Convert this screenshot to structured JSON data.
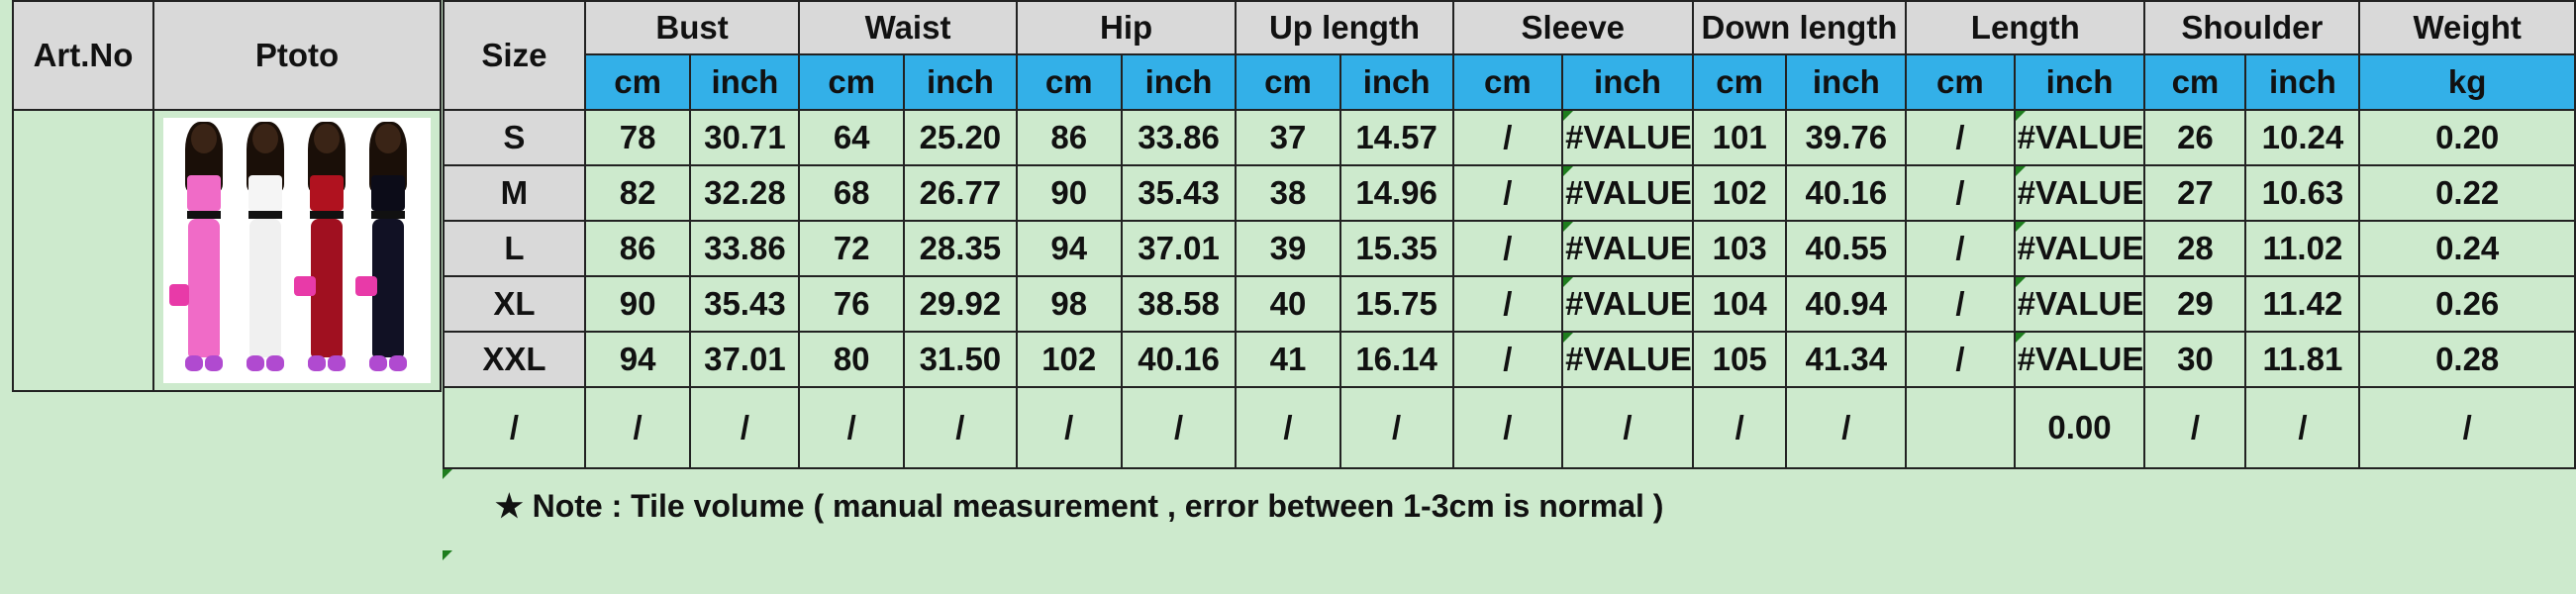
{
  "left_table": {
    "art_no_header": "Art.No",
    "photo_header": "Ptoto",
    "art_no_value": ""
  },
  "photo": {
    "description_icon": "product-photo",
    "figures": [
      {
        "top_color": "#f06bc7",
        "legs_color": "#f06bc7"
      },
      {
        "top_color": "#f5f5f5",
        "legs_color": "#f0f0f0"
      },
      {
        "top_color": "#b0121f",
        "legs_color": "#a01020"
      },
      {
        "top_color": "#0c0c18",
        "legs_color": "#111124"
      }
    ]
  },
  "size_table": {
    "size_header": "Size",
    "groups": [
      {
        "name": "Bust",
        "units": [
          "cm",
          "inch"
        ]
      },
      {
        "name": "Waist",
        "units": [
          "cm",
          "inch"
        ]
      },
      {
        "name": "Hip",
        "units": [
          "cm",
          "inch"
        ]
      },
      {
        "name": "Up length",
        "units": [
          "cm",
          "inch"
        ]
      },
      {
        "name": "Sleeve",
        "units": [
          "cm",
          "inch"
        ]
      },
      {
        "name": "Down length",
        "units": [
          "cm",
          "inch"
        ]
      },
      {
        "name": "Length",
        "units": [
          "cm",
          "inch"
        ]
      },
      {
        "name": "Shoulder",
        "units": [
          "cm",
          "inch"
        ]
      },
      {
        "name": "Weight",
        "units": [
          "kg"
        ]
      }
    ],
    "rows": [
      {
        "size": "S",
        "cells": [
          "78",
          "30.71",
          "64",
          "25.20",
          "86",
          "33.86",
          "37",
          "14.57",
          "/",
          "#VALUE",
          "101",
          "39.76",
          "/",
          "#VALUE",
          "26",
          "10.24",
          "0.20"
        ]
      },
      {
        "size": "M",
        "cells": [
          "82",
          "32.28",
          "68",
          "26.77",
          "90",
          "35.43",
          "38",
          "14.96",
          "/",
          "#VALUE",
          "102",
          "40.16",
          "/",
          "#VALUE",
          "27",
          "10.63",
          "0.22"
        ]
      },
      {
        "size": "L",
        "cells": [
          "86",
          "33.86",
          "72",
          "28.35",
          "94",
          "37.01",
          "39",
          "15.35",
          "/",
          "#VALUE",
          "103",
          "40.55",
          "/",
          "#VALUE",
          "28",
          "11.02",
          "0.24"
        ]
      },
      {
        "size": "XL",
        "cells": [
          "90",
          "35.43",
          "76",
          "29.92",
          "98",
          "38.58",
          "40",
          "15.75",
          "/",
          "#VALUE",
          "104",
          "40.94",
          "/",
          "#VALUE",
          "29",
          "11.42",
          "0.26"
        ]
      },
      {
        "size": "XXL",
        "cells": [
          "94",
          "37.01",
          "80",
          "31.50",
          "102",
          "40.16",
          "41",
          "16.14",
          "/",
          "#VALUE",
          "105",
          "41.34",
          "/",
          "#VALUE",
          "30",
          "11.81",
          "0.28"
        ]
      }
    ],
    "extra_row": {
      "size": "/",
      "cells": [
        "/",
        "/",
        "/",
        "/",
        "/",
        "/",
        "/",
        "/",
        "/",
        "/",
        "/",
        "/",
        "",
        "0.00",
        "/",
        "/",
        "/"
      ]
    }
  },
  "note": "★ Note : Tile volume ( manual measurement , error between 1-3cm is normal )",
  "colors": {
    "background": "#cdeacd",
    "header_gray": "#d9d9d9",
    "unit_blue": "#33b0e8",
    "error_marker": "#1e7d1e"
  }
}
